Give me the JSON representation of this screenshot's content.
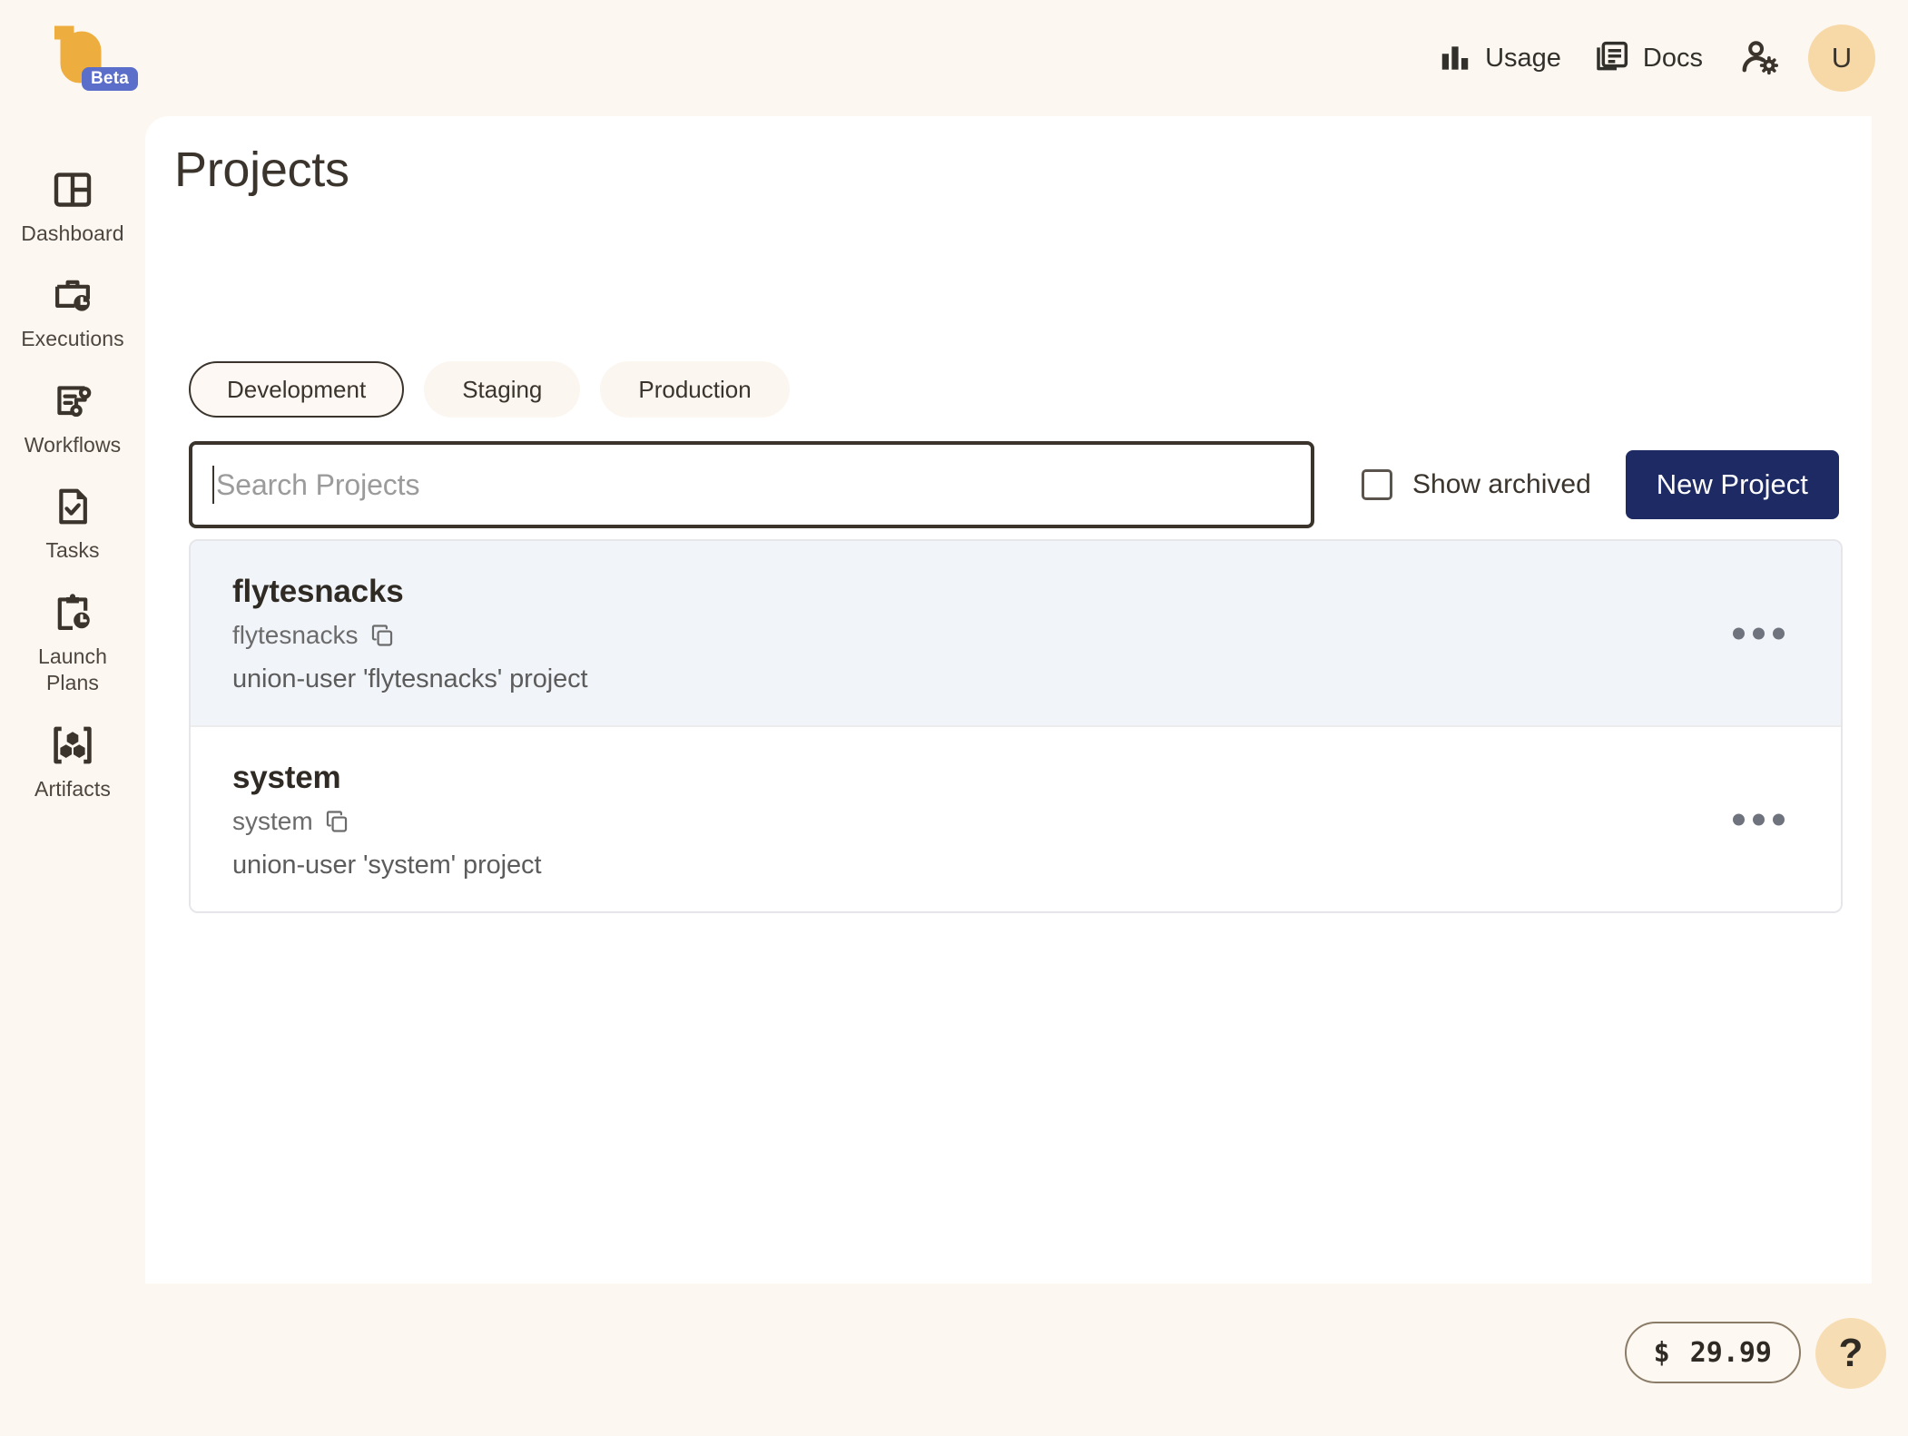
{
  "brand": {
    "logo_alt": "union-logo",
    "badge": "Beta",
    "badge_color": "#5b6ec9",
    "logo_color": "#eeae3f"
  },
  "header": {
    "usage_label": "Usage",
    "docs_label": "Docs",
    "user_settings_icon": "user-settings-icon",
    "avatar_initial": "U",
    "avatar_color": "#f7d9a8"
  },
  "sidebar": {
    "items": [
      {
        "label": "Dashboard",
        "icon": "dashboard-icon"
      },
      {
        "label": "Executions",
        "icon": "briefcase-clock-icon"
      },
      {
        "label": "Workflows",
        "icon": "workflow-branch-icon"
      },
      {
        "label": "Tasks",
        "icon": "document-check-icon"
      },
      {
        "label": "Launch\nPlans",
        "icon": "clipboard-clock-icon"
      },
      {
        "label": "Artifacts",
        "icon": "artifacts-cubes-icon"
      }
    ]
  },
  "main": {
    "title": "Projects",
    "tabs": [
      {
        "label": "Development",
        "selected": true
      },
      {
        "label": "Staging",
        "selected": false
      },
      {
        "label": "Production",
        "selected": false
      }
    ],
    "search": {
      "placeholder": "Search Projects",
      "value": "",
      "focused": true
    },
    "show_archived": {
      "label": "Show archived",
      "checked": false
    },
    "new_project_label": "New Project",
    "new_project_color": "#1e2a63",
    "projects": [
      {
        "name": "flytesnacks",
        "id": "flytesnacks",
        "description": "union-user 'flytesnacks' project",
        "highlighted": true,
        "copy_icon": "copy-icon",
        "menu_icon": "more-options-icon"
      },
      {
        "name": "system",
        "id": "system",
        "description": "union-user 'system' project",
        "highlighted": false,
        "copy_icon": "copy-icon",
        "menu_icon": "more-options-icon"
      }
    ]
  },
  "footer": {
    "cost_currency": "$",
    "cost_value": "29.99",
    "help_label": "?"
  }
}
